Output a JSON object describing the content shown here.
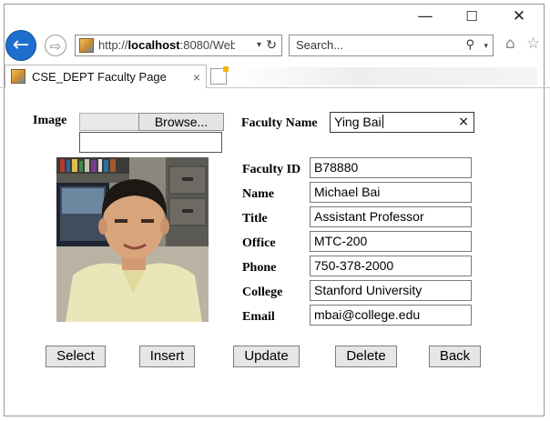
{
  "window": {
    "controls": {
      "minimize": "—",
      "maximize": "☐",
      "close": "✕"
    }
  },
  "navigation": {
    "back_glyph": "←",
    "forward_glyph": "⇨",
    "address": {
      "prefix": "http://",
      "host": "localhost",
      "rest": ":8080/Web",
      "dropdown": "▾",
      "refresh": "↻"
    },
    "search": {
      "placeholder": "Search...",
      "icon": "⚲",
      "dropdown": "▾"
    },
    "home_glyph": "⌂",
    "favorites_glyph": "☆"
  },
  "tab": {
    "title": "CSE_DEPT Faculty Page",
    "close": "×"
  },
  "form": {
    "image_label": "Image",
    "browse_label": "Browse...",
    "image_path_value": "",
    "faculty_name_label": "Faculty Name",
    "faculty_name_value": "Ying Bai",
    "clear_glyph": "×",
    "fields": [
      {
        "label": "Faculty ID",
        "value": "B78880"
      },
      {
        "label": "Name",
        "value": "Michael Bai"
      },
      {
        "label": "Title",
        "value": "Assistant Professor"
      },
      {
        "label": "Office",
        "value": "MTC-200"
      },
      {
        "label": "Phone",
        "value": "750-378-2000"
      },
      {
        "label": "College",
        "value": "Stanford University"
      },
      {
        "label": "Email",
        "value": "mbai@college.edu"
      }
    ]
  },
  "actions": {
    "select": "Select",
    "insert": "Insert",
    "update": "Update",
    "delete": "Delete",
    "back": "Back"
  }
}
